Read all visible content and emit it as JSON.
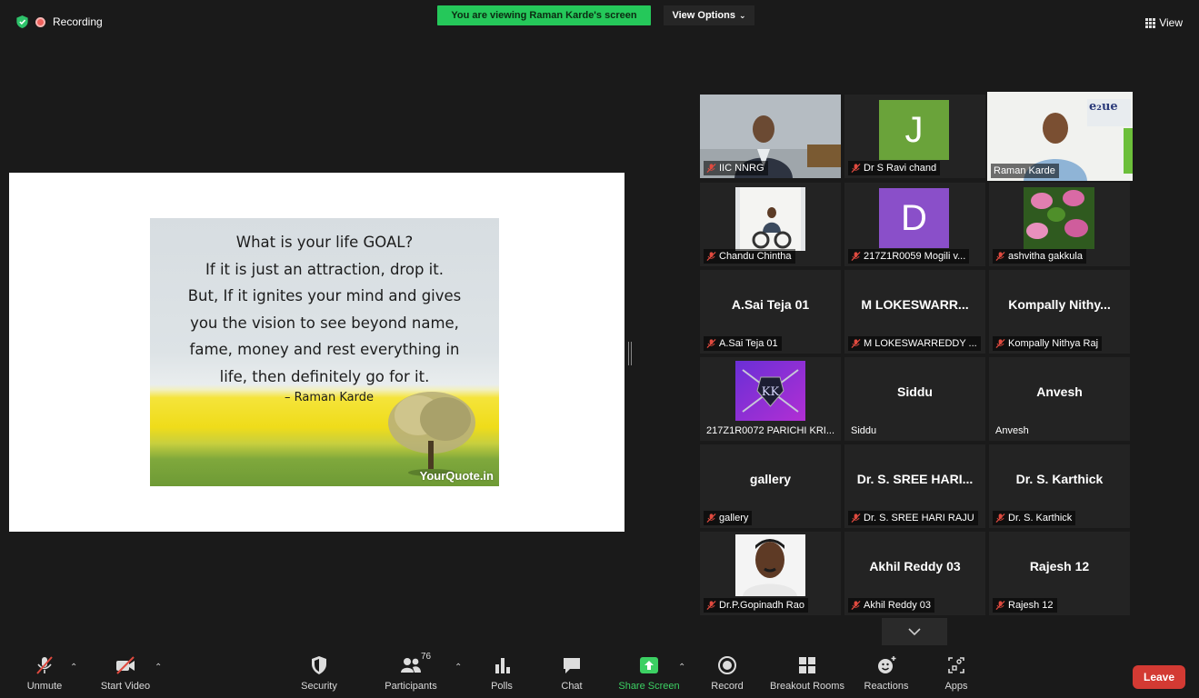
{
  "top": {
    "recording_label": "Recording",
    "banner": "You are viewing Raman Karde's screen",
    "view_options": "View Options",
    "view_label": "View"
  },
  "shared_screen": {
    "quote_lines": [
      "What is your life GOAL?",
      "If it is just an attraction, drop it.",
      "But, If it ignites your mind and gives",
      "you the vision to see beyond name,",
      "fame, money and rest everything in",
      "life, then definitely go for it."
    ],
    "author": "– Raman Karde",
    "watermark": "YourQuote.in"
  },
  "participants": [
    {
      "label": "IIC NNRG",
      "muted": true,
      "kind": "video"
    },
    {
      "label": "Dr S Ravi chand",
      "muted": true,
      "kind": "avatar",
      "initial": "J",
      "color": "#6aa33a"
    },
    {
      "label": "Raman Karde",
      "muted": false,
      "kind": "video",
      "active": true
    },
    {
      "label": "Chandu Chintha",
      "muted": true,
      "kind": "photo"
    },
    {
      "label": "217Z1R0059 Mogili v...",
      "muted": true,
      "kind": "avatar",
      "initial": "D",
      "color": "#8a4fc9"
    },
    {
      "label": "ashvitha gakkula",
      "muted": true,
      "kind": "photo"
    },
    {
      "label": "A.Sai Teja 01",
      "center": "A.Sai Teja 01",
      "muted": true,
      "kind": "name"
    },
    {
      "label": "M LOKESWARREDDY ...",
      "center": "M LOKESWARR...",
      "muted": true,
      "kind": "name"
    },
    {
      "label": "Kompally Nithya Raj",
      "center": "Kompally Nithy...",
      "muted": true,
      "kind": "name"
    },
    {
      "label": "217Z1R0072 PARICHI KRI...",
      "muted": false,
      "kind": "logo",
      "logo_text": "KK"
    },
    {
      "label": "Siddu",
      "center": "Siddu",
      "muted": false,
      "kind": "name"
    },
    {
      "label": "Anvesh",
      "center": "Anvesh",
      "muted": false,
      "kind": "name"
    },
    {
      "label": "gallery",
      "center": "gallery",
      "muted": true,
      "kind": "name"
    },
    {
      "label": "Dr. S. SREE HARI RAJU",
      "center": "Dr. S. SREE HARI...",
      "muted": true,
      "kind": "name"
    },
    {
      "label": "Dr. S. Karthick",
      "center": "Dr. S. Karthick",
      "muted": true,
      "kind": "name"
    },
    {
      "label": "Dr.P.Gopinadh Rao",
      "muted": true,
      "kind": "photo"
    },
    {
      "label": "Akhil Reddy 03",
      "center": "Akhil Reddy 03",
      "muted": true,
      "kind": "name"
    },
    {
      "label": "Rajesh 12",
      "center": "Rajesh 12",
      "muted": true,
      "kind": "name"
    }
  ],
  "toolbar": {
    "unmute": "Unmute",
    "start_video": "Start Video",
    "security": "Security",
    "participants": "Participants",
    "participants_count": "76",
    "polls": "Polls",
    "chat": "Chat",
    "share_screen": "Share Screen",
    "record": "Record",
    "breakout_rooms": "Breakout Rooms",
    "reactions": "Reactions",
    "apps": "Apps",
    "leave": "Leave"
  },
  "colors": {
    "banner_green": "#25c85a",
    "leave_red": "#d33a33",
    "active_speaker": "#c9df3f",
    "share_green": "#3cd063",
    "mute_red": "#e04a3f"
  }
}
